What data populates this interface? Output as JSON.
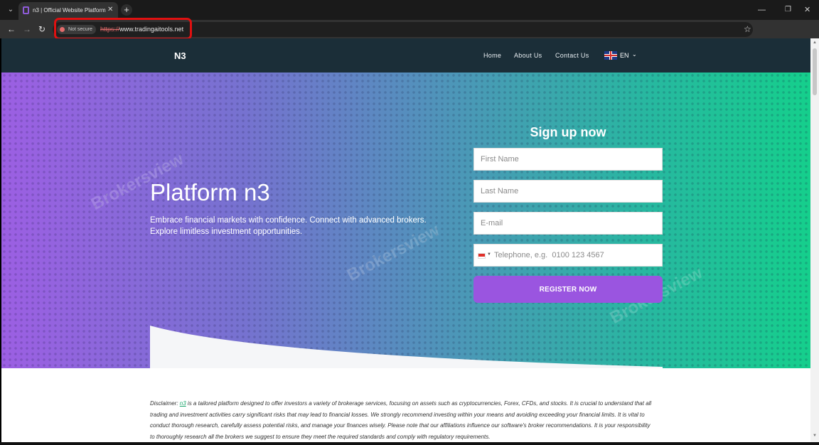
{
  "browser": {
    "tab_title": "n3 | Official Website Platform",
    "security_label": "Not secure",
    "url_protocol": "https://",
    "url_host": "www.tradingaitools.net"
  },
  "header": {
    "logo": "N3",
    "nav": [
      "Home",
      "About Us",
      "Contact Us"
    ],
    "language": "EN"
  },
  "hero": {
    "title": "Platform n3",
    "text": "Embrace financial markets with confidence. Connect with advanced brokers. Explore limitless investment opportunities."
  },
  "signup": {
    "title": "Sign up now",
    "first_name_placeholder": "First Name",
    "last_name_placeholder": "Last Name",
    "email_placeholder": "E-mail",
    "phone_placeholder": "Telephone, e.g.  0100 123 4567",
    "register_label": "REGISTER NOW"
  },
  "disclaimer": {
    "prefix": "Disclaimer: ",
    "link": "n3",
    "text": " is a tailored platform designed to offer investors a variety of brokerage services, focusing on assets such as cryptocurrencies, Forex, CFDs, and stocks. It is crucial to understand that all trading and investment activities carry significant risks that may lead to financial losses. We strongly recommend investing within your means and avoiding exceeding your financial limits. It is vital to conduct thorough research, carefully assess potential risks, and manage your finances wisely. Please note that our affiliations influence our software's broker recommendations. It is your responsibility to thoroughly research all the brokers we suggest to ensure they meet the required standards and comply with regulatory requirements."
  },
  "watermark": "Brokersview",
  "colors": {
    "header_bg": "#1b2e38",
    "hero_gradient_start": "#9c5fe3",
    "hero_gradient_end": "#15cf8c",
    "register_button": "#9a55e0",
    "link": "#1aa56b"
  }
}
